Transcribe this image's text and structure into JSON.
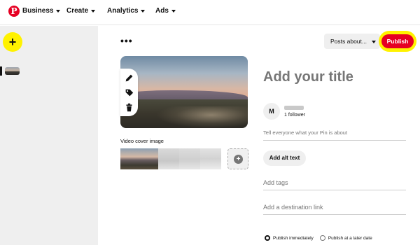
{
  "nav": {
    "logo_letter": "P",
    "items": [
      {
        "label": "Business"
      },
      {
        "label": "Create"
      },
      {
        "label": "Analytics"
      },
      {
        "label": "Ads"
      }
    ]
  },
  "rail": {
    "add_label": "+"
  },
  "toolbar": {
    "more_label": "•••",
    "board_select": "Posts about...",
    "publish_label": "Publish"
  },
  "media": {
    "cover_label": "Video cover image",
    "add_frame_label": "+"
  },
  "form": {
    "title_placeholder": "Add your title",
    "avatar_letter": "M",
    "followers": "1 follower",
    "about_placeholder": "Tell everyone what your Pin is about",
    "alt_text_label": "Add alt text",
    "tags_placeholder": "Add tags",
    "link_placeholder": "Add a destination link",
    "publish_options": [
      {
        "label": "Publish immediately",
        "selected": true
      },
      {
        "label": "Publish at a later date",
        "selected": false
      }
    ]
  },
  "colors": {
    "brand": "#e60023",
    "highlight": "#fff200"
  }
}
